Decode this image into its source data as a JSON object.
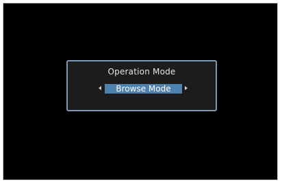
{
  "dialog": {
    "title": "Operation Mode",
    "selected_value": "Browse Mode",
    "left_arrow_icon": "triangle-left-icon",
    "right_arrow_icon": "triangle-right-icon"
  },
  "colors": {
    "screen_background": "#000000",
    "dialog_background": "#1c1c1c",
    "dialog_border": "#7f9ab2",
    "selection_highlight": "#4f81ad"
  }
}
